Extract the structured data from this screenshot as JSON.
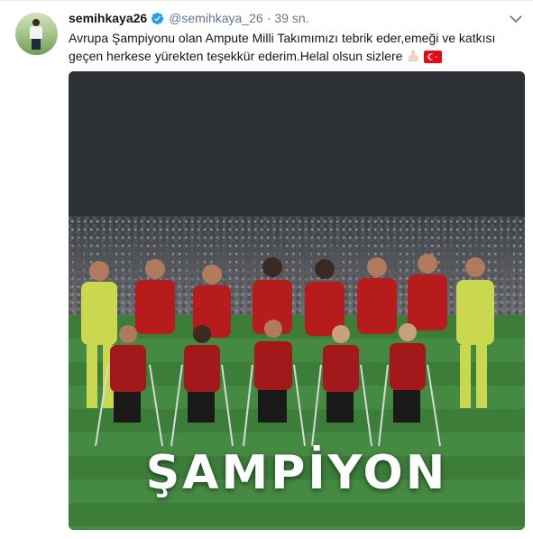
{
  "tweet": {
    "display_name": "semihkaya26",
    "handle": "@semihkaya_26",
    "separator": "·",
    "time": "39 sn.",
    "text": "Avrupa Şampiyonu olan Ampute Milli Takımımızı tebrik eder,emeği ve katkısı geçen herkese yürekten teşekkür ederim.Helal olsun sizlere",
    "emojis": [
      "flexed-biceps-icon",
      "turkey-flag-icon"
    ]
  },
  "media": {
    "caption": "ŞAMPİYON"
  },
  "colors": {
    "name": "#14171a",
    "secondary": "#657786",
    "verified": "#1da1f2",
    "flag_red": "#e30a17"
  }
}
